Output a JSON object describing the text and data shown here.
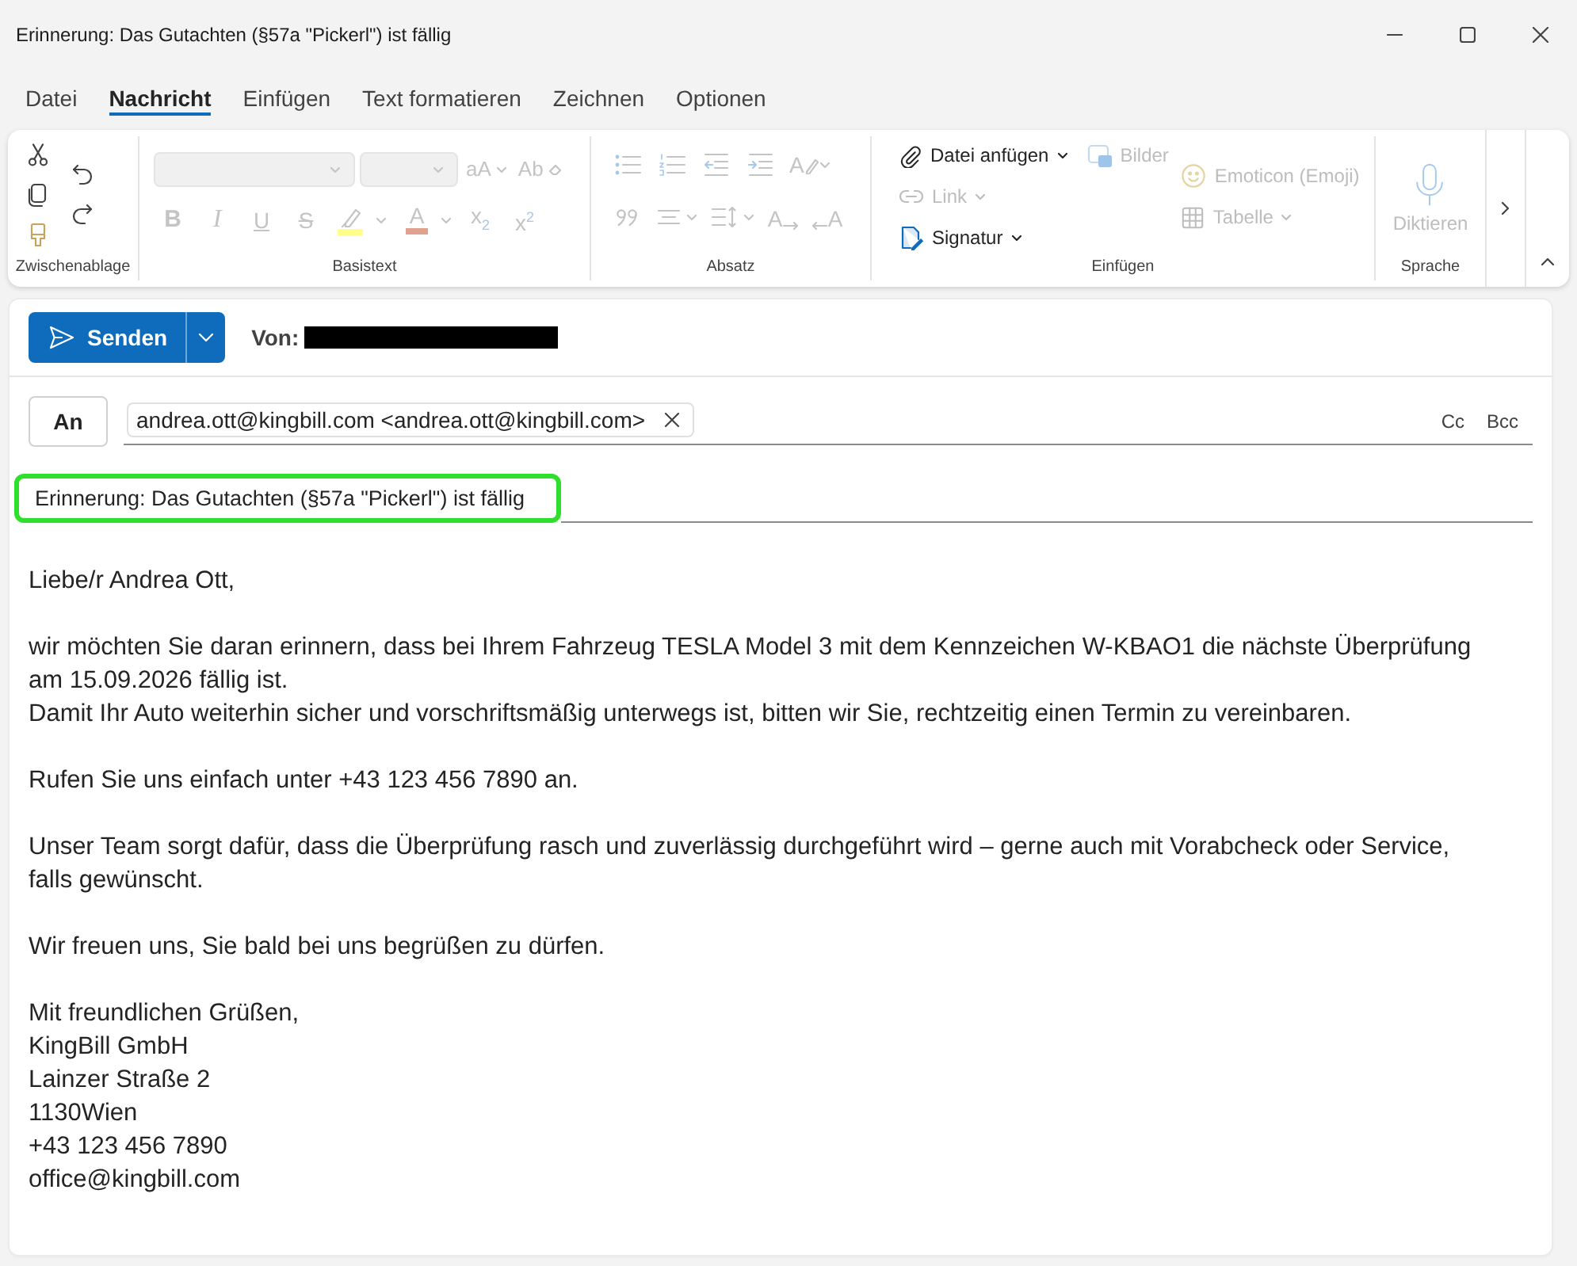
{
  "window": {
    "title": "Erinnerung: Das Gutachten (§57a \"Pickerl\") ist fällig"
  },
  "tabs": [
    {
      "label": "Datei",
      "selected": false
    },
    {
      "label": "Nachricht",
      "selected": true
    },
    {
      "label": "Einfügen",
      "selected": false
    },
    {
      "label": "Text formatieren",
      "selected": false
    },
    {
      "label": "Zeichnen",
      "selected": false
    },
    {
      "label": "Optionen",
      "selected": false
    }
  ],
  "ribbon": {
    "clipboard": {
      "label": "Zwischenablage",
      "tools": [
        {
          "kind": "cut",
          "disabled": false
        },
        {
          "kind": "copy",
          "disabled": false
        },
        {
          "kind": "format-painter",
          "disabled": false
        },
        {
          "kind": "undo",
          "disabled": false
        },
        {
          "kind": "redo",
          "disabled": false
        }
      ]
    },
    "basic_text": {
      "label": "Basistext",
      "upper_tools": [
        {
          "kind": "font-dropdown",
          "disabled": true
        },
        {
          "kind": "size-dropdown",
          "disabled": true
        },
        {
          "kind": "grow-shrink",
          "glyph": "aA",
          "dropdown": true,
          "disabled": true
        },
        {
          "kind": "clear-format",
          "glyph": "Ab",
          "dropdown": false,
          "disabled": true
        }
      ],
      "lower_tools": [
        {
          "kind": "bold",
          "glyph": "B",
          "disabled": true
        },
        {
          "kind": "italic",
          "glyph": "I",
          "disabled": true
        },
        {
          "kind": "underline",
          "glyph": "U",
          "disabled": true
        },
        {
          "kind": "strike",
          "glyph": "S",
          "disabled": true
        },
        {
          "kind": "highlight",
          "dropdown": true,
          "disabled": true
        },
        {
          "kind": "font-color",
          "glyph": "A",
          "dropdown": true,
          "disabled": true
        },
        {
          "kind": "subscript",
          "glyph": "x$_{2}$",
          "disabled": true
        },
        {
          "kind": "superscript",
          "glyph": "x$^{2}$",
          "disabled": true
        }
      ]
    },
    "paragraph": {
      "label": "Absatz",
      "upper_tools": [
        {
          "kind": "bullets",
          "disabled": true
        },
        {
          "kind": "numbering",
          "disabled": true
        },
        {
          "kind": "outdent",
          "disabled": true
        },
        {
          "kind": "indent",
          "disabled": true
        },
        {
          "kind": "styles",
          "glyph": "A",
          "dropdown": true,
          "disabled": true
        }
      ],
      "lower_tools": [
        {
          "kind": "quote",
          "disabled": true
        },
        {
          "kind": "align",
          "dropdown": true,
          "disabled": true
        },
        {
          "kind": "line-spacing",
          "dropdown": true,
          "disabled": true
        },
        {
          "kind": "ltr",
          "glyph": "A",
          "disabled": true
        },
        {
          "kind": "rtl",
          "glyph": "A",
          "disabled": true
        }
      ]
    },
    "insert": {
      "label": "Einfügen",
      "columns": [
        [
          {
            "kind": "attach",
            "label": "Datei anfügen",
            "dropdown": true,
            "disabled": false
          },
          {
            "kind": "link",
            "label": "Link",
            "dropdown": true,
            "disabled": true
          },
          {
            "kind": "signature",
            "label": "Signatur",
            "dropdown": true,
            "disabled": false
          }
        ],
        [
          {
            "kind": "pictures",
            "label": "Bilder",
            "dropdown": false,
            "disabled": true
          }
        ],
        [
          {
            "kind": "emoji",
            "label": "Emoticon (Emoji)",
            "dropdown": false,
            "disabled": true
          },
          {
            "kind": "table",
            "label": "Tabelle",
            "dropdown": true,
            "disabled": true
          }
        ]
      ]
    },
    "voice": {
      "label": "Sprache",
      "tools": [
        {
          "kind": "dictate",
          "label": "Diktieren",
          "disabled": true
        }
      ]
    }
  },
  "compose": {
    "send": {
      "label": "Senden"
    },
    "from": {
      "label": "Von:",
      "redacted": true
    },
    "to": {
      "button": "An",
      "recipients": [
        {
          "text": "andrea.ott@kingbill.com <andrea.ott@kingbill.com>"
        }
      ],
      "cc": "Cc",
      "bcc": "Bcc"
    },
    "subject": {
      "value": "Erinnerung: Das Gutachten (§57a \"Pickerl\") ist fällig",
      "highlighted": true
    },
    "body": [
      [
        "Liebe/r Andrea Ott,"
      ],
      [
        "wir möchten Sie daran erinnern, dass bei Ihrem Fahrzeug TESLA Model 3 mit dem Kennzeichen W-KBAO1 die nächste Überprüfung am 15.09.2026 fällig ist.",
        "Damit Ihr Auto weiterhin sicher und vorschriftsmäßig unterwegs ist, bitten wir Sie, rechtzeitig einen Termin zu vereinbaren."
      ],
      [
        "Rufen Sie uns einfach unter +43 123 456 7890 an."
      ],
      [
        "Unser Team sorgt dafür, dass die Überprüfung rasch und zuverlässig durchgeführt wird – gerne auch mit Vorabcheck oder Service, falls gewünscht."
      ],
      [
        "Wir freuen uns, Sie bald bei uns begrüßen zu dürfen."
      ],
      [
        "Mit freundlichen Grüßen,",
        "KingBill GmbH",
        "Lainzer Straße 2",
        "1130Wien",
        "+43 123 456 7890",
        "office@kingbill.com"
      ]
    ]
  }
}
